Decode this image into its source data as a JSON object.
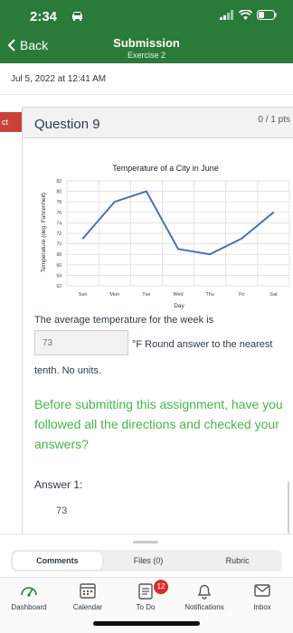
{
  "status_bar": {
    "time": "2:34"
  },
  "header": {
    "back_label": "Back",
    "title": "Submission",
    "subtitle": "Exercise 2"
  },
  "timestamp": "Jul 5, 2022 at 12:41 AM",
  "left_tab_label": "ct",
  "question": {
    "title": "Question 9",
    "points": "0 / 1 pts",
    "prompt": "The average temperature for the week is",
    "answer_value": "73",
    "unit_text": "°F Round answer to the nearest",
    "unit_text_cont": "tenth. No units.",
    "notice": "Before submitting this assignment, have you followed all the directions and checked your answers?",
    "answer_label": "Answer 1:",
    "answer_display": "73"
  },
  "chart_data": {
    "type": "line",
    "title": "Temperature of a City in June",
    "xlabel": "Day",
    "ylabel": "Temperature (deg. Fahrenheit)",
    "categories": [
      "Sun",
      "Mon",
      "Tue",
      "Wed",
      "Thu",
      "Fri",
      "Sat"
    ],
    "values": [
      71,
      78,
      80,
      69,
      68,
      71,
      76
    ],
    "ylim": [
      62,
      82
    ],
    "yticks": [
      "62",
      "64",
      "66",
      "68",
      "70",
      "72",
      "74",
      "76",
      "78",
      "80",
      "82"
    ],
    "grid": true,
    "line_color": "#4a72b8"
  },
  "drawer": {
    "tabs": [
      "Comments",
      "Files (0)",
      "Rubric"
    ],
    "active": "Comments"
  },
  "tabbar": {
    "items": [
      "Dashboard",
      "Calendar",
      "To Do",
      "Notifications",
      "Inbox"
    ],
    "todo_badge": "12"
  },
  "colors": {
    "header": "#2a7a3a",
    "notice": "#49b54a",
    "badge": "#d32f2f"
  }
}
